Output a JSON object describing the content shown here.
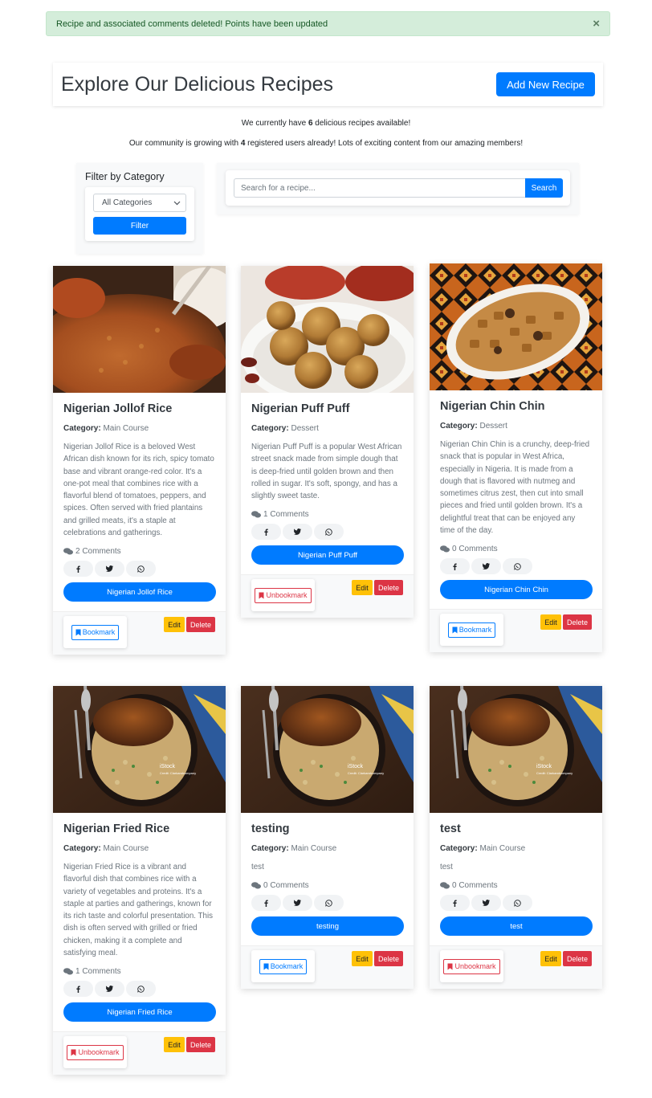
{
  "alert": {
    "message": "Recipe and associated comments deleted! Points have been updated",
    "close": "×"
  },
  "header": {
    "title": "Explore Our Delicious Recipes",
    "add_button": "Add New Recipe"
  },
  "stats": {
    "recipes_pre": "We currently have ",
    "recipes_count": "6",
    "recipes_post": " delicious recipes available!",
    "users_pre": "Our community is growing with ",
    "users_count": "4",
    "users_post": " registered users already! Lots of exciting content from our amazing members!"
  },
  "filter": {
    "title": "Filter by Category",
    "selected": "All Categories",
    "button": "Filter"
  },
  "search": {
    "placeholder": "Search for a recipe...",
    "button": "Search"
  },
  "recipes": [
    {
      "title": "Nigerian Jollof Rice",
      "category_label": "Category:",
      "category": " Main Course",
      "description": "Nigerian Jollof Rice is a beloved West African dish known for its rich, spicy tomato base and vibrant orange-red color. It's a one-pot meal that combines rice with a flavorful blend of tomatoes, peppers, and spices. Often served with fried plantains and grilled meats, it's a staple at celebrations and gatherings.",
      "comments": "2 Comments",
      "view_button": "Nigerian Jollof Rice",
      "bookmark": "Bookmark",
      "edit": "Edit",
      "delete": "Delete"
    },
    {
      "title": "Nigerian Puff Puff",
      "category_label": "Category:",
      "category": " Dessert",
      "description": "Nigerian Puff Puff is a popular West African street snack made from simple dough that is deep-fried until golden brown and then rolled in sugar. It's soft, spongy, and has a slightly sweet taste.",
      "comments": "1 Comments",
      "view_button": "Nigerian Puff Puff",
      "bookmark": "Unbookmark",
      "edit": "Edit",
      "delete": "Delete"
    },
    {
      "title": "Nigerian Chin Chin",
      "category_label": "Category:",
      "category": " Dessert",
      "description": "Nigerian Chin Chin is a crunchy, deep-fried snack that is popular in West Africa, especially in Nigeria. It is made from a dough that is flavored with nutmeg and sometimes citrus zest, then cut into small pieces and fried until golden brown. It's a delightful treat that can be enjoyed any time of the day.",
      "comments": "0 Comments",
      "view_button": "Nigerian Chin Chin",
      "bookmark": "Bookmark",
      "edit": "Edit",
      "delete": "Delete"
    },
    {
      "title": "Nigerian Fried Rice",
      "category_label": "Category:",
      "category": " Main Course",
      "description": "Nigerian Fried Rice is a vibrant and flavorful dish that combines rice with a variety of vegetables and proteins. It's a staple at parties and gatherings, known for its rich taste and colorful presentation. This dish is often served with grilled or fried chicken, making it a complete and satisfying meal.",
      "comments": "1 Comments",
      "view_button": "Nigerian Fried Rice",
      "bookmark": "Unbookmark",
      "edit": "Edit",
      "delete": "Delete"
    },
    {
      "title": "testing",
      "category_label": "Category:",
      "category": " Main Course",
      "description": "test",
      "comments": "0 Comments",
      "view_button": "testing",
      "bookmark": "Bookmark",
      "edit": "Edit",
      "delete": "Delete"
    },
    {
      "title": "test",
      "category_label": "Category:",
      "category": " Main Course",
      "description": "test",
      "comments": "0 Comments",
      "view_button": "test",
      "bookmark": "Unbookmark",
      "edit": "Edit",
      "delete": "Delete"
    }
  ],
  "watermark": {
    "brand": "iStock",
    "credit": "Credit: Clarkandcompany"
  },
  "colors": {
    "primary": "#007bff",
    "warning": "#ffc107",
    "danger": "#dc3545",
    "success_bg": "#d4edda"
  }
}
